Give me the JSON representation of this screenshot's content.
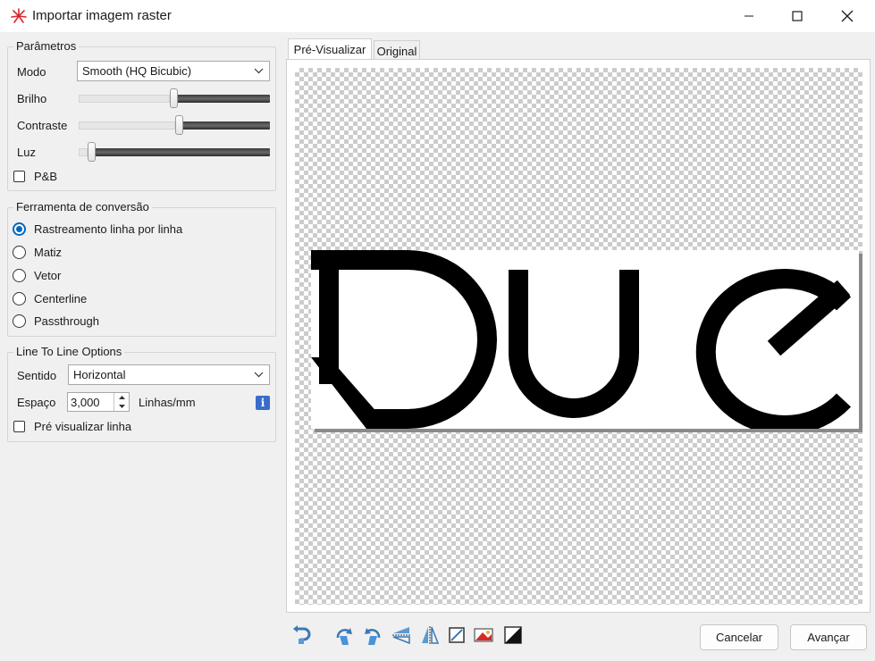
{
  "window": {
    "title": "Importar imagem raster"
  },
  "params": {
    "group_label": "Parâmetros",
    "mode_label": "Modo",
    "mode_value": "Smooth (HQ Bicubic)",
    "brightness_label": "Brilho",
    "brightness_value": 0.5,
    "contrast_label": "Contraste",
    "contrast_value": 0.53,
    "light_label": "Luz",
    "light_value": 0.05,
    "bw_label": "P&B"
  },
  "conversion": {
    "group_label": "Ferramenta de conversão",
    "options": [
      {
        "label": "Rastreamento linha por linha",
        "selected": true
      },
      {
        "label": "Matiz",
        "selected": false
      },
      {
        "label": "Vetor",
        "selected": false
      },
      {
        "label": "Centerline",
        "selected": false
      },
      {
        "label": "Passthrough",
        "selected": false
      }
    ]
  },
  "line_options": {
    "group_label": "Line To Line Options",
    "direction_label": "Sentido",
    "direction_value": "Horizontal",
    "spacing_label": "Espaço",
    "spacing_value": "3,000",
    "spacing_unit": "Linhas/mm",
    "preview_line_label": "Pré visualizar linha"
  },
  "tabs": [
    {
      "label": "Pré-Visualizar",
      "active": true
    },
    {
      "label": "Original",
      "active": false
    }
  ],
  "buttons": {
    "cancel": "Cancelar",
    "next": "Avançar"
  },
  "icons": {
    "app": "laser-logo-icon",
    "toolbar": [
      "undo-icon",
      "rotate-left-icon",
      "rotate-right-icon",
      "flip-vertical-icon",
      "flip-horizontal-icon",
      "crop-icon",
      "color-adjust-icon",
      "invert-icon"
    ]
  },
  "colors": {
    "accent": "#0067c0",
    "info": "#3a6ccd"
  }
}
